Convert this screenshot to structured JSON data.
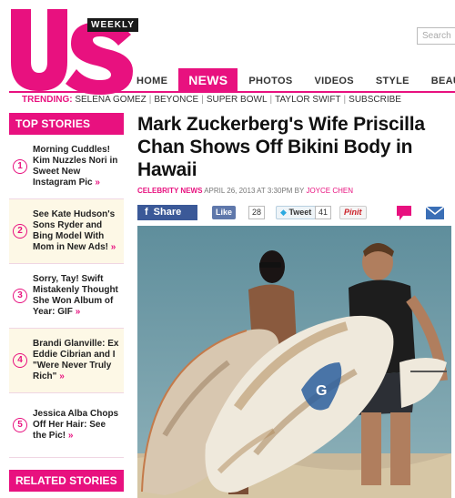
{
  "brand": {
    "logo_text": "Us",
    "logo_sub": "WEEKLY",
    "accent_color": "#e8117f"
  },
  "search": {
    "placeholder": "Search"
  },
  "nav": {
    "items": [
      {
        "label": "HOME"
      },
      {
        "label": "NEWS",
        "active": true
      },
      {
        "label": "PHOTOS"
      },
      {
        "label": "VIDEOS"
      },
      {
        "label": "STYLE"
      },
      {
        "label": "BEAUTY"
      }
    ]
  },
  "trending": {
    "label": "TRENDING:",
    "items": [
      "SELENA GOMEZ",
      "BEYONCE",
      "SUPER BOWL",
      "TAYLOR SWIFT",
      "SUBSCRIBE"
    ]
  },
  "sidebar": {
    "top_stories_label": "TOP STORIES",
    "stories": [
      {
        "num": "1",
        "text": "Morning Cuddles! Kim Nuzzles Nori in Sweet New Instagram Pic",
        "arrow": "»"
      },
      {
        "num": "2",
        "text": "See Kate Hudson's Sons Ryder and Bing Model With Mom in New Ads!",
        "arrow": "»"
      },
      {
        "num": "3",
        "text": "Sorry, Tay! Swift Mistakenly Thought She Won Album of Year: GIF",
        "arrow": "»"
      },
      {
        "num": "4",
        "text": "Brandi Glanville: Ex Eddie Cibrian and I \"Were Never Truly Rich\"",
        "arrow": "»"
      },
      {
        "num": "5",
        "text": "Jessica Alba Chops Off Her Hair: See the Pic!",
        "arrow": "»"
      }
    ],
    "related_label": "RELATED STORIES"
  },
  "article": {
    "headline": "Mark Zuckerberg's Wife Priscilla Chan Shows Off Bikini Body in Hawaii",
    "category": "CELEBRITY NEWS",
    "date": "APRIL 26, 2013 AT 3:30PM BY",
    "author": "JOYCE CHEN"
  },
  "share": {
    "fb_share": "Share",
    "fb_glyph": "f",
    "like": "Like",
    "like_count": "28",
    "tweet": "Tweet",
    "tweet_count": "41",
    "pinit": "Pinit"
  },
  "photo": {
    "board_mark": "G"
  }
}
